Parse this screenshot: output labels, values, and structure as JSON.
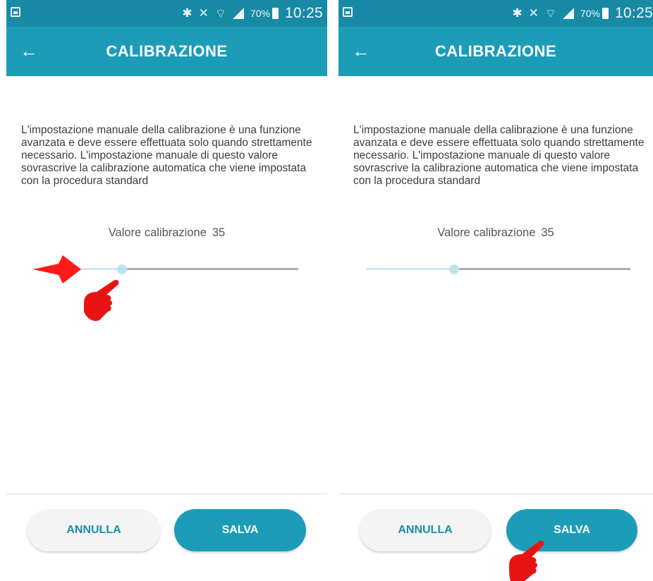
{
  "status_bar": {
    "battery_percent": "70%",
    "time": "10:25"
  },
  "app_bar": {
    "title": "CALIBRAZIONE",
    "back_icon": "arrow-left-icon"
  },
  "content": {
    "description": "L'impostazione manuale della calibrazione è una funzione avanzata e deve essere effettuata solo quando strettamente necessario. L'impostazione manuale di questo valore sovrascrive la calibrazione automatica che viene impostata con la procedura standard",
    "calibration_label": "Valore calibrazione",
    "calibration_value": "35"
  },
  "slider": {
    "value": 35
  },
  "buttons": {
    "cancel_label": "ANNULLA",
    "save_label": "SALVA"
  },
  "colors": {
    "primary": "#1d9cb8",
    "status_bar": "#198aa5",
    "annotation_red": "#ff1a1a"
  },
  "annotations": [
    "red-arrow-icon",
    "pointing-hand-icon"
  ]
}
